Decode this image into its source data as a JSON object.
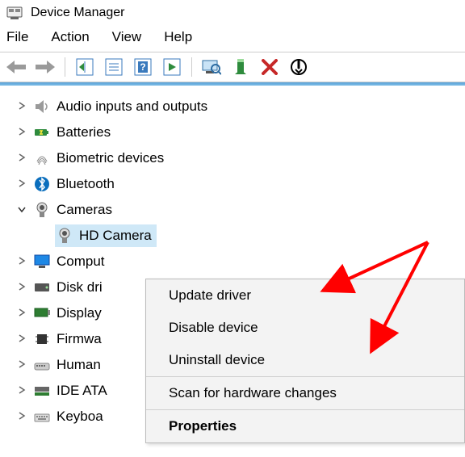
{
  "title": "Device Manager",
  "menubar": [
    "File",
    "Action",
    "View",
    "Help"
  ],
  "tree": [
    {
      "id": "audio",
      "label": "Audio inputs and outputs",
      "expanded": false
    },
    {
      "id": "batteries",
      "label": "Batteries",
      "expanded": false
    },
    {
      "id": "biometric",
      "label": "Biometric devices",
      "expanded": false
    },
    {
      "id": "bluetooth",
      "label": "Bluetooth",
      "expanded": false
    },
    {
      "id": "cameras",
      "label": "Cameras",
      "expanded": true,
      "children": [
        {
          "id": "hdcamera",
          "label": "HD Camera",
          "selected": true
        }
      ]
    },
    {
      "id": "computer",
      "label": "Computer",
      "expanded": false,
      "truncated": "Comput"
    },
    {
      "id": "disk",
      "label": "Disk drives",
      "expanded": false,
      "truncated": "Disk dri"
    },
    {
      "id": "display",
      "label": "Display adapters",
      "expanded": false,
      "truncated": "Display"
    },
    {
      "id": "firmware",
      "label": "Firmware",
      "expanded": false,
      "truncated": "Firmwa"
    },
    {
      "id": "hid",
      "label": "Human Interface Devices",
      "expanded": false,
      "truncated": "Human"
    },
    {
      "id": "ide",
      "label": "IDE ATA/ATAPI controllers",
      "expanded": false,
      "truncated": "IDE ATA"
    },
    {
      "id": "keyboard",
      "label": "Keyboards",
      "expanded": false,
      "truncated": "Keyboa"
    }
  ],
  "context_menu": {
    "items": [
      {
        "label": "Update driver"
      },
      {
        "label": "Disable device"
      },
      {
        "label": "Uninstall device"
      }
    ],
    "items2": [
      {
        "label": "Scan for hardware changes"
      }
    ],
    "items3": [
      {
        "label": "Properties",
        "bold": true
      }
    ]
  }
}
